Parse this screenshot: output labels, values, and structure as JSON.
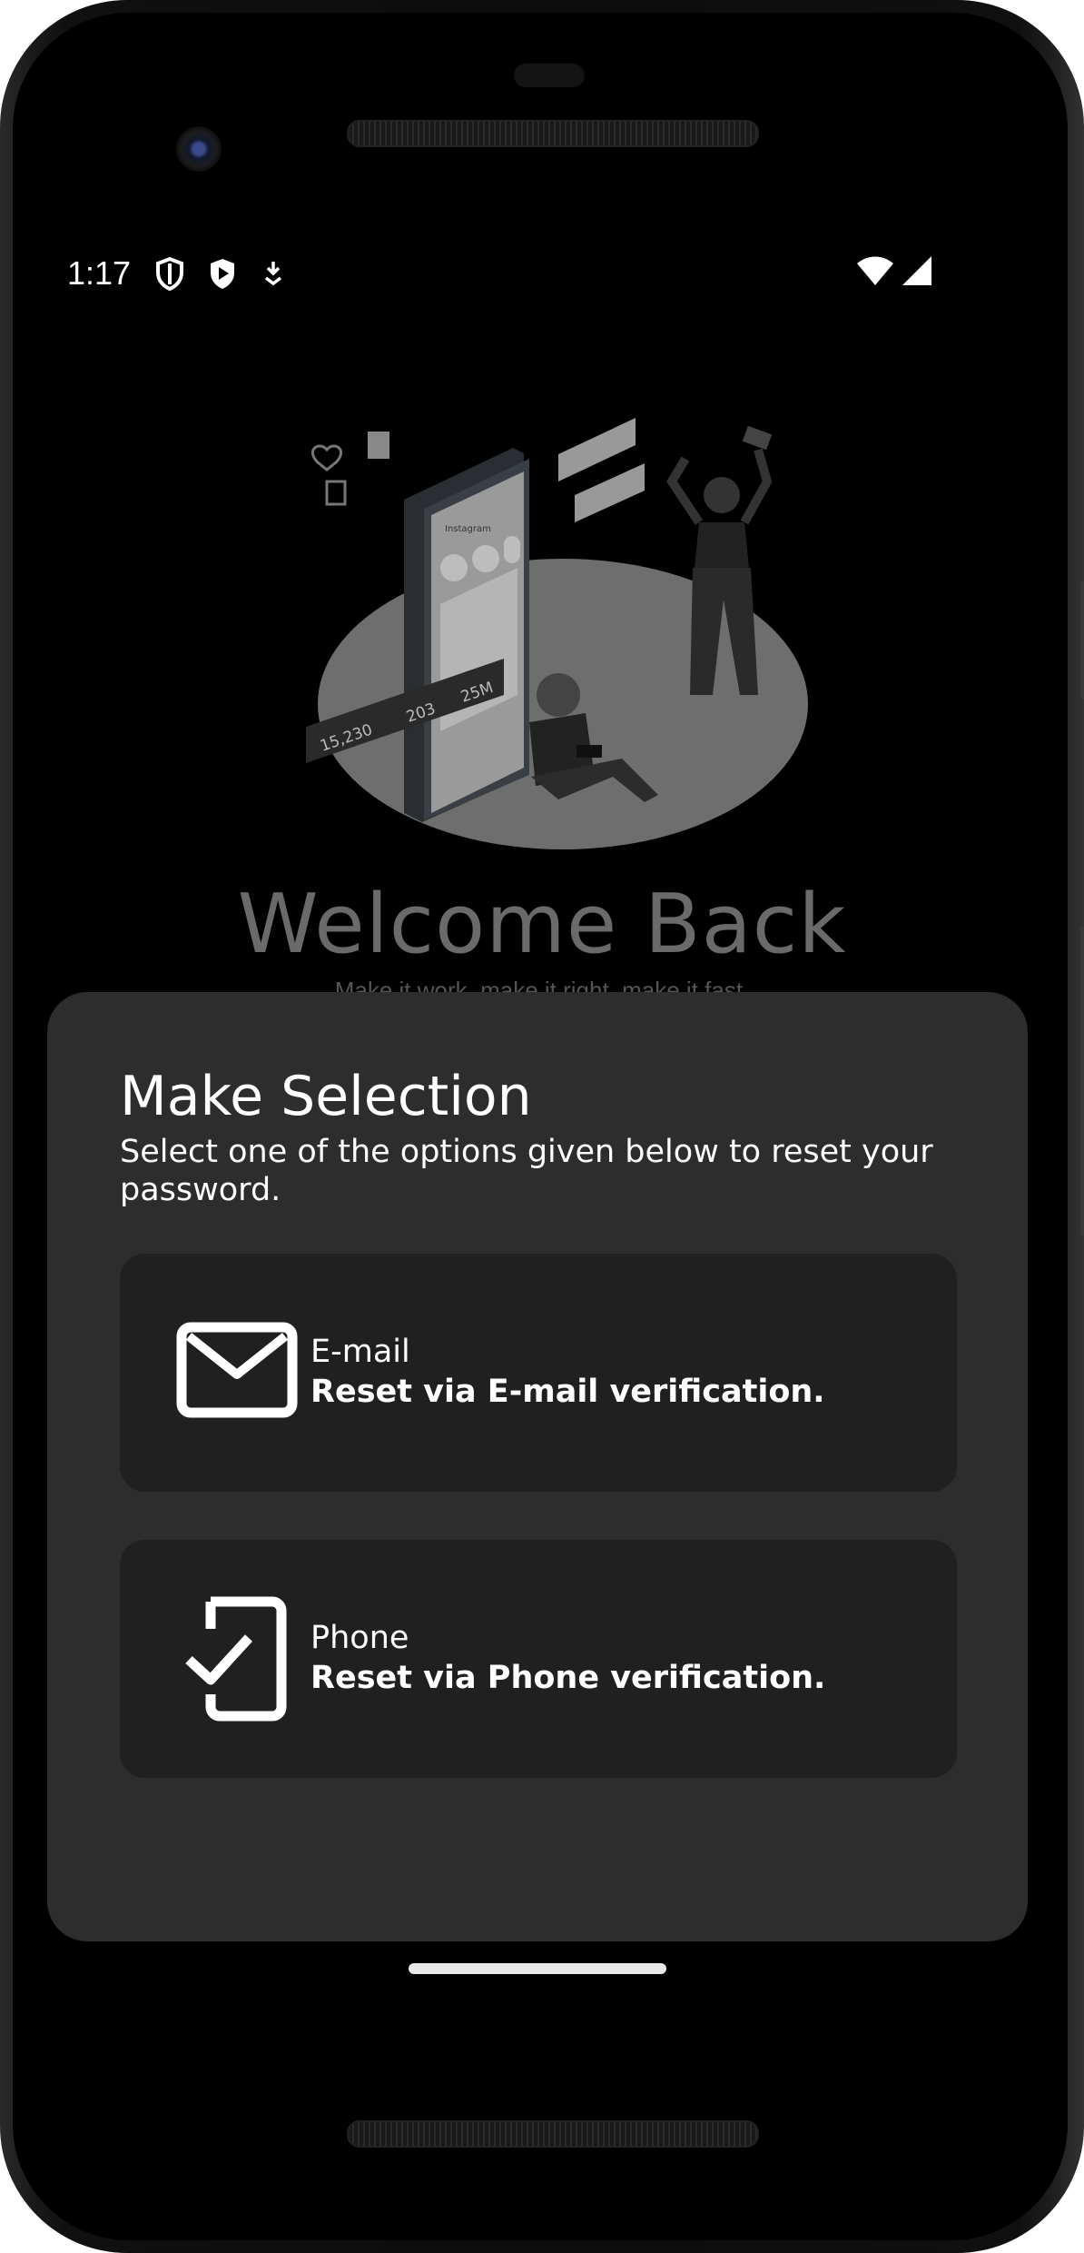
{
  "status_bar": {
    "time": "1:17"
  },
  "welcome": {
    "title": "Welcome Back",
    "subtitle": "Make it work, make it right, make it fast."
  },
  "illustration": {
    "stat_likes": "15,230",
    "stat_comments": "203",
    "stat_followers": "25M",
    "screen_title": "Instagram"
  },
  "sheet": {
    "title": "Make Selection",
    "description": "Select one of the options given below to reset your password.",
    "options": [
      {
        "title": "E-mail",
        "subtitle": "Reset via E-mail verification.",
        "icon": "mail-outline-icon"
      },
      {
        "title": "Phone",
        "subtitle": "Reset via Phone verification.",
        "icon": "mobile-check-icon"
      }
    ]
  },
  "colors": {
    "sheet_bg": "#2d2d2d",
    "card_bg": "#202020",
    "text": "#ffffff",
    "muted": "#6a6a6a"
  }
}
